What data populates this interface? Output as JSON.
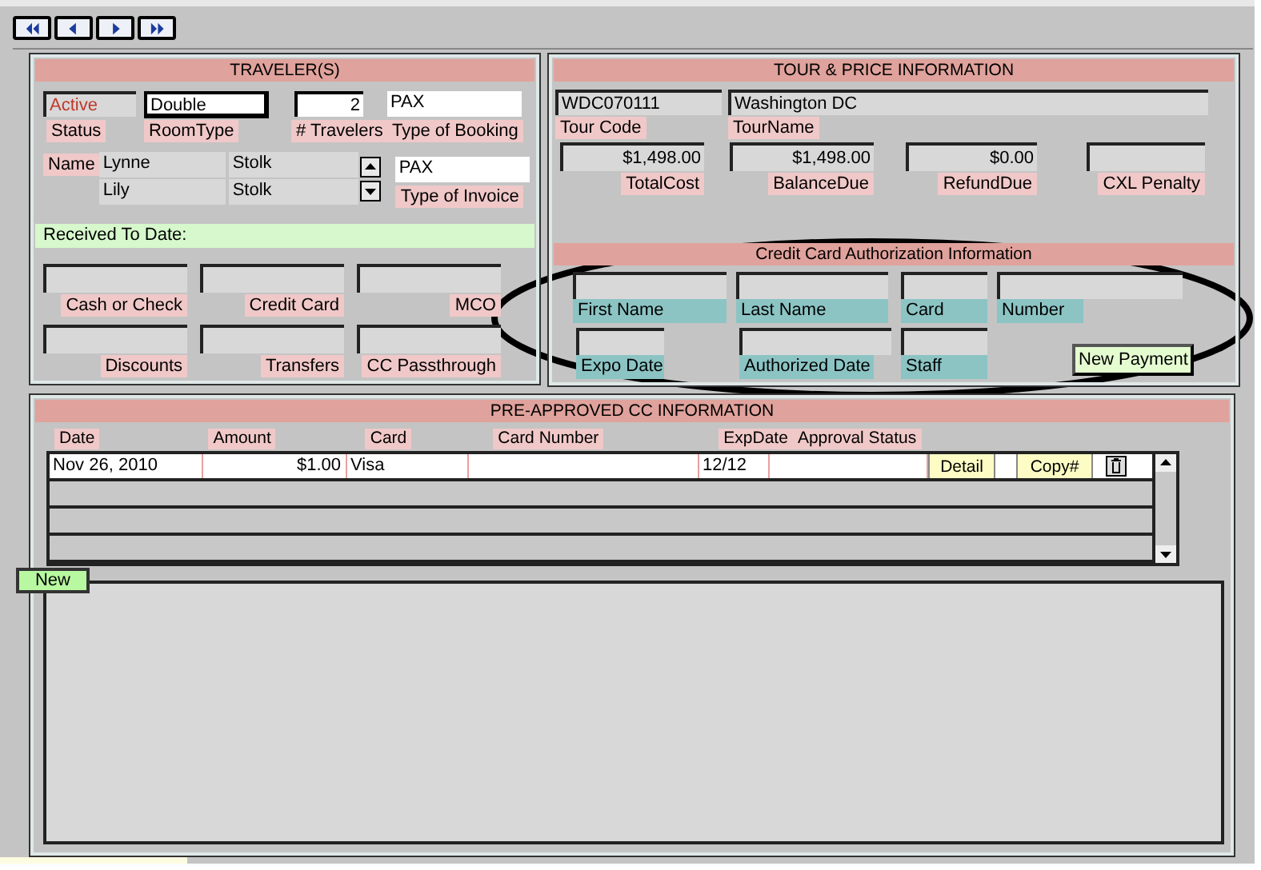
{
  "traveler": {
    "title": "TRAVELER(S)",
    "status": {
      "value": "Active",
      "label": "Status"
    },
    "room_type": {
      "value": "Double",
      "label": "RoomType"
    },
    "travelers": {
      "value": "2",
      "label": "# Travelers"
    },
    "type_of_booking": {
      "value": "PAX",
      "label": "Type of Booking"
    },
    "name_label": "Name",
    "names": [
      {
        "first": "Lynne",
        "last": "Stolk"
      },
      {
        "first": "Lily",
        "last": "Stolk"
      }
    ],
    "type_of_invoice": {
      "value": "PAX",
      "label": "Type of Invoice"
    },
    "received_title": "Received To Date:",
    "received_fields": [
      {
        "label": "Cash or Check"
      },
      {
        "label": "Credit Card"
      },
      {
        "label": "MCO"
      },
      {
        "label": "Discounts"
      },
      {
        "label": "Transfers"
      },
      {
        "label": "CC Passthrough"
      }
    ]
  },
  "tour": {
    "title": "TOUR & PRICE INFORMATION",
    "tour_code": {
      "value": "WDC070111",
      "label": "Tour Code"
    },
    "tour_name": {
      "value": "Washington DC",
      "label": "TourName"
    },
    "amounts": [
      {
        "value": "$1,498.00",
        "label": "TotalCost"
      },
      {
        "value": "$1,498.00",
        "label": "BalanceDue"
      },
      {
        "value": "$0.00",
        "label": "RefundDue"
      },
      {
        "label": "CXL Penalty"
      }
    ],
    "cc_title": "Credit Card Authorization Information",
    "cc_fields": [
      {
        "label": "First Name"
      },
      {
        "label": "Last Name"
      },
      {
        "label": "Card"
      },
      {
        "label": "Number"
      },
      {
        "label": "Expo Date"
      },
      {
        "label": "Authorized Date"
      },
      {
        "label": "Staff"
      }
    ],
    "new_payment": "New Payment"
  },
  "pre_approved": {
    "title": "PRE-APPROVED CC INFORMATION",
    "columns": [
      "Date",
      "Amount",
      "Card",
      "Card Number",
      "ExpDate",
      "Approval Status"
    ],
    "rows": [
      {
        "date": "Nov 26, 2010",
        "amount": "$1.00",
        "card": "Visa",
        "exp_date": "12/12",
        "detail": "Detail",
        "copy": "Copy#"
      }
    ],
    "new_button": "New"
  }
}
